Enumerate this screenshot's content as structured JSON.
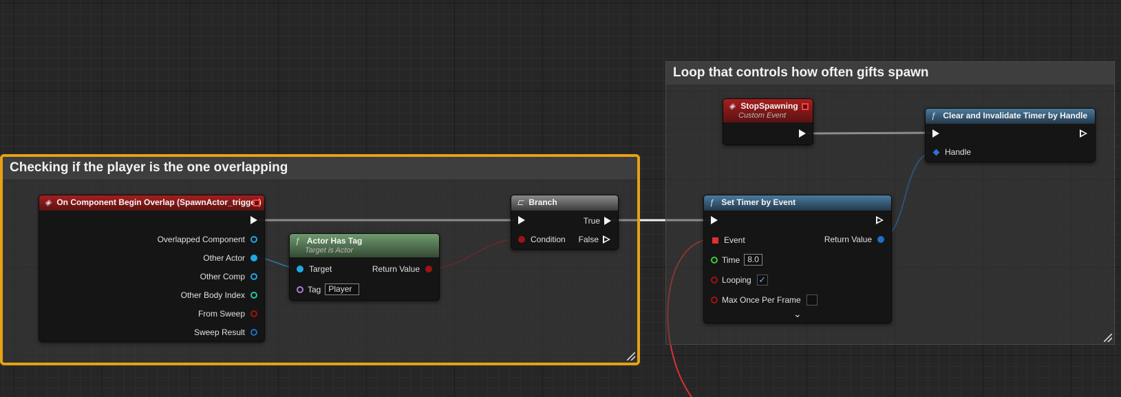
{
  "comments": {
    "checking": "Checking if the player is the one overlapping",
    "loop": "Loop that controls how often gifts spawn"
  },
  "overlap_node": {
    "title": "On Component Begin Overlap (SpawnActor_trigger)",
    "pins": [
      "Overlapped Component",
      "Other Actor",
      "Other Comp",
      "Other Body Index",
      "From Sweep",
      "Sweep Result"
    ]
  },
  "has_tag_node": {
    "title": "Actor Has Tag",
    "subtitle": "Target is Actor",
    "target": "Target",
    "return_value": "Return Value",
    "tag_label": "Tag",
    "tag_value": "Player"
  },
  "branch_node": {
    "title": "Branch",
    "true_label": "True",
    "false_label": "False",
    "condition": "Condition"
  },
  "stop_node": {
    "title": "StopSpawning",
    "subtitle": "Custom Event"
  },
  "clear_node": {
    "title": "Clear and Invalidate Timer by Handle",
    "handle": "Handle"
  },
  "timer_node": {
    "title": "Set Timer by Event",
    "event": "Event",
    "return_value": "Return Value",
    "time_label": "Time",
    "time_value": "8.0",
    "looping_label": "Looping",
    "looping_checked": "✓",
    "max_once_label": "Max Once Per Frame",
    "expand": "⌄"
  },
  "colors": {
    "object_pin": "#1fa8e8",
    "int_pin": "#1fc9a0",
    "bool_pin": "#a11212",
    "struct_pin": "#1d6fc2",
    "float_pin": "#3fc93f",
    "name_pin": "#b07ee0",
    "selection": "#e8a115"
  }
}
